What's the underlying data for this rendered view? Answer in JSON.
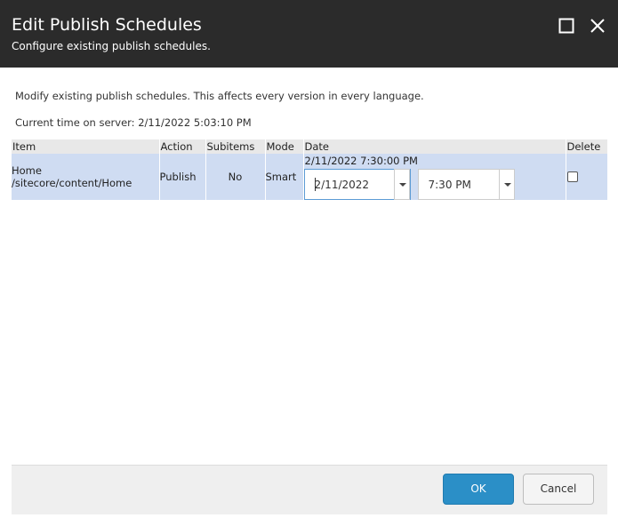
{
  "dialog": {
    "title": "Edit Publish Schedules",
    "subtitle": "Configure existing publish schedules."
  },
  "body": {
    "intro": "Modify existing publish schedules. This affects every version in every language.",
    "server_time": "Current time on server: 2/11/2022 5:03:10 PM"
  },
  "table": {
    "columns": [
      "Item",
      "Action",
      "Subitems",
      "Mode",
      "Date",
      "Delete"
    ],
    "rows": [
      {
        "item_name": "Home",
        "item_path": "/sitecore/content/Home",
        "action": "Publish",
        "subitems": "No",
        "mode": "Smart",
        "date_text": "2/11/2022 7:30:00 PM",
        "date_value": "2/11/2022",
        "time_value": "7:30 PM",
        "delete_checked": false
      }
    ]
  },
  "footer": {
    "ok_label": "OK",
    "cancel_label": "Cancel"
  },
  "colors": {
    "header_bg": "#2b2b2b",
    "row_bg": "#cfdcf2",
    "ok_bg": "#2b8fc7"
  }
}
